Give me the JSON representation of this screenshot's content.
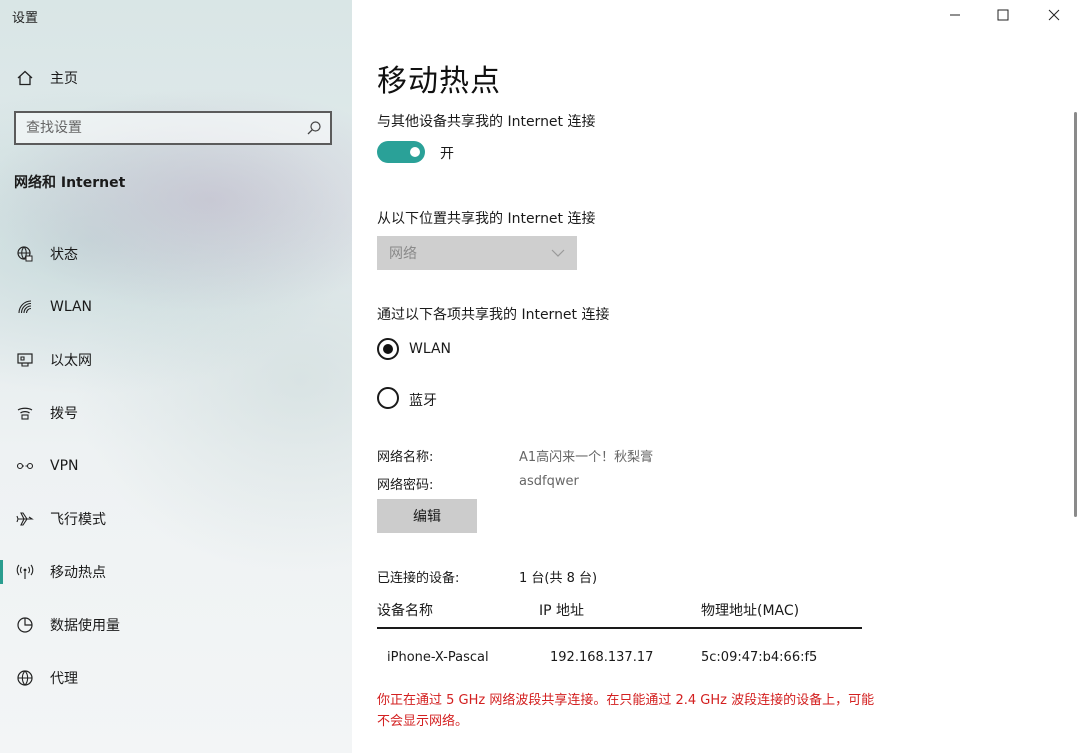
{
  "window": {
    "title": "设置",
    "controls": [
      "minimize",
      "maximize",
      "close"
    ]
  },
  "sidebar": {
    "home_label": "主页",
    "search_placeholder": "查找设置",
    "section_title": "网络和 Internet",
    "items": [
      {
        "label": "状态",
        "icon": "status-globe-icon"
      },
      {
        "label": "WLAN",
        "icon": "wifi-icon"
      },
      {
        "label": "以太网",
        "icon": "ethernet-icon"
      },
      {
        "label": "拨号",
        "icon": "dialup-icon"
      },
      {
        "label": "VPN",
        "icon": "vpn-icon"
      },
      {
        "label": "飞行模式",
        "icon": "airplane-icon"
      },
      {
        "label": "移动热点",
        "icon": "hotspot-icon",
        "active": true
      },
      {
        "label": "数据使用量",
        "icon": "data-usage-icon"
      },
      {
        "label": "代理",
        "icon": "proxy-globe-icon"
      }
    ]
  },
  "main": {
    "title": "移动热点",
    "share_label": "与其他设备共享我的 Internet 连接",
    "toggle_state": "开",
    "share_from_label": "从以下位置共享我的 Internet 连接",
    "share_from_value": "网络",
    "share_via_label": "通过以下各项共享我的 Internet 连接",
    "share_via_options": [
      {
        "label": "WLAN",
        "checked": true
      },
      {
        "label": "蓝牙",
        "checked": false
      }
    ],
    "network_name_label": "网络名称:",
    "network_name_value": "A1高闪来一个！秋梨膏",
    "network_password_label": "网络密码:",
    "network_password_value": "asdfqwer",
    "edit_button": "编辑",
    "connected_label": "已连接的设备:",
    "connected_value": "1 台(共 8 台)",
    "table": {
      "headers": [
        "设备名称",
        "IP 地址",
        "物理地址(MAC)"
      ],
      "rows": [
        [
          "iPhone-X-Pascal",
          "192.168.137.17",
          "5c:09:47:b4:66:f5"
        ]
      ]
    },
    "warning": "你正在通过 5 GHz 网络波段共享连接。在只能通过 2.4 GHz 波段连接的设备上，可能不会显示网络。"
  },
  "colors": {
    "accent": "#2aa198",
    "warning": "#d32020"
  }
}
